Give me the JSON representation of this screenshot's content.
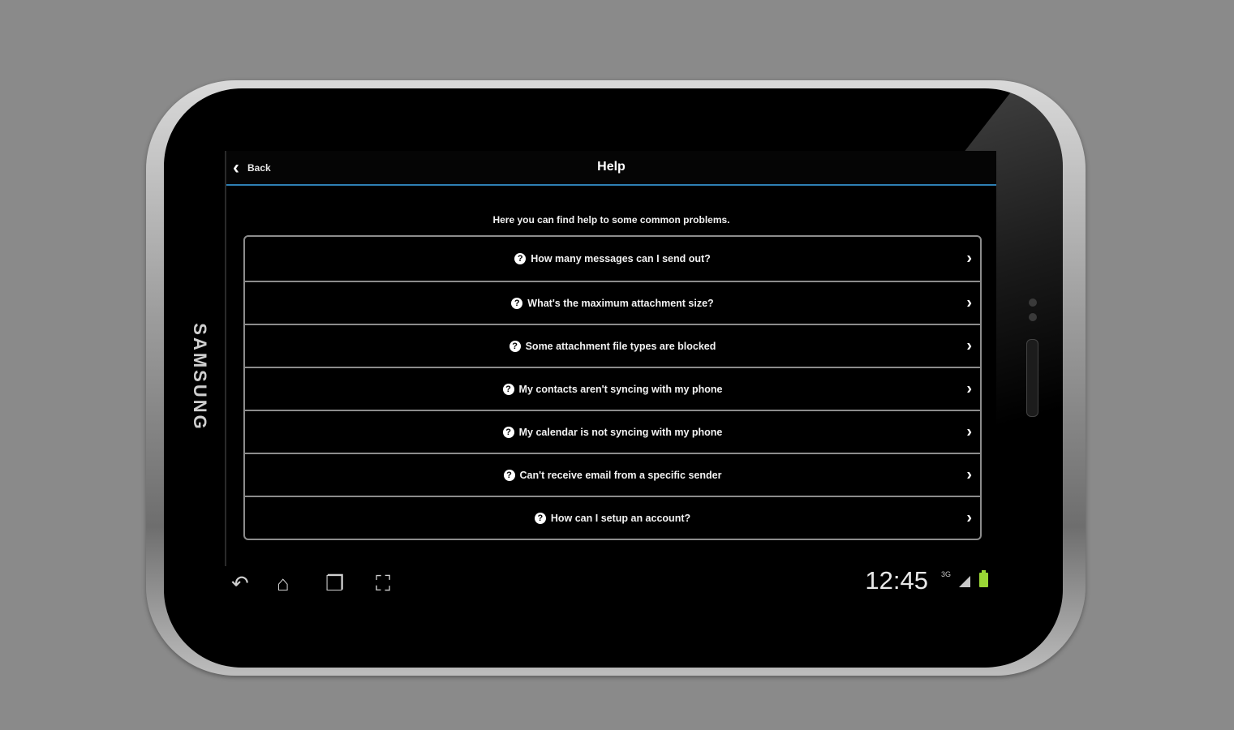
{
  "device": {
    "brand": "SAMSUNG"
  },
  "appbar": {
    "back_label": "Back",
    "title": "Help"
  },
  "intro": "Here you can find help to some common problems.",
  "faq": [
    {
      "question": "How many messages can I send out?"
    },
    {
      "question": "What's the maximum attachment size?"
    },
    {
      "question": "Some attachment file types are blocked"
    },
    {
      "question": "My contacts aren't syncing with my phone"
    },
    {
      "question": "My calendar is not syncing with my phone"
    },
    {
      "question": "Can't receive email from a specific sender"
    },
    {
      "question": "How can I setup an account?"
    }
  ],
  "status_bar": {
    "time": "12:45",
    "network": "3G",
    "battery_color": "#9ad636"
  },
  "colors": {
    "accent_line": "#2e7fb3",
    "background": "#000000"
  }
}
